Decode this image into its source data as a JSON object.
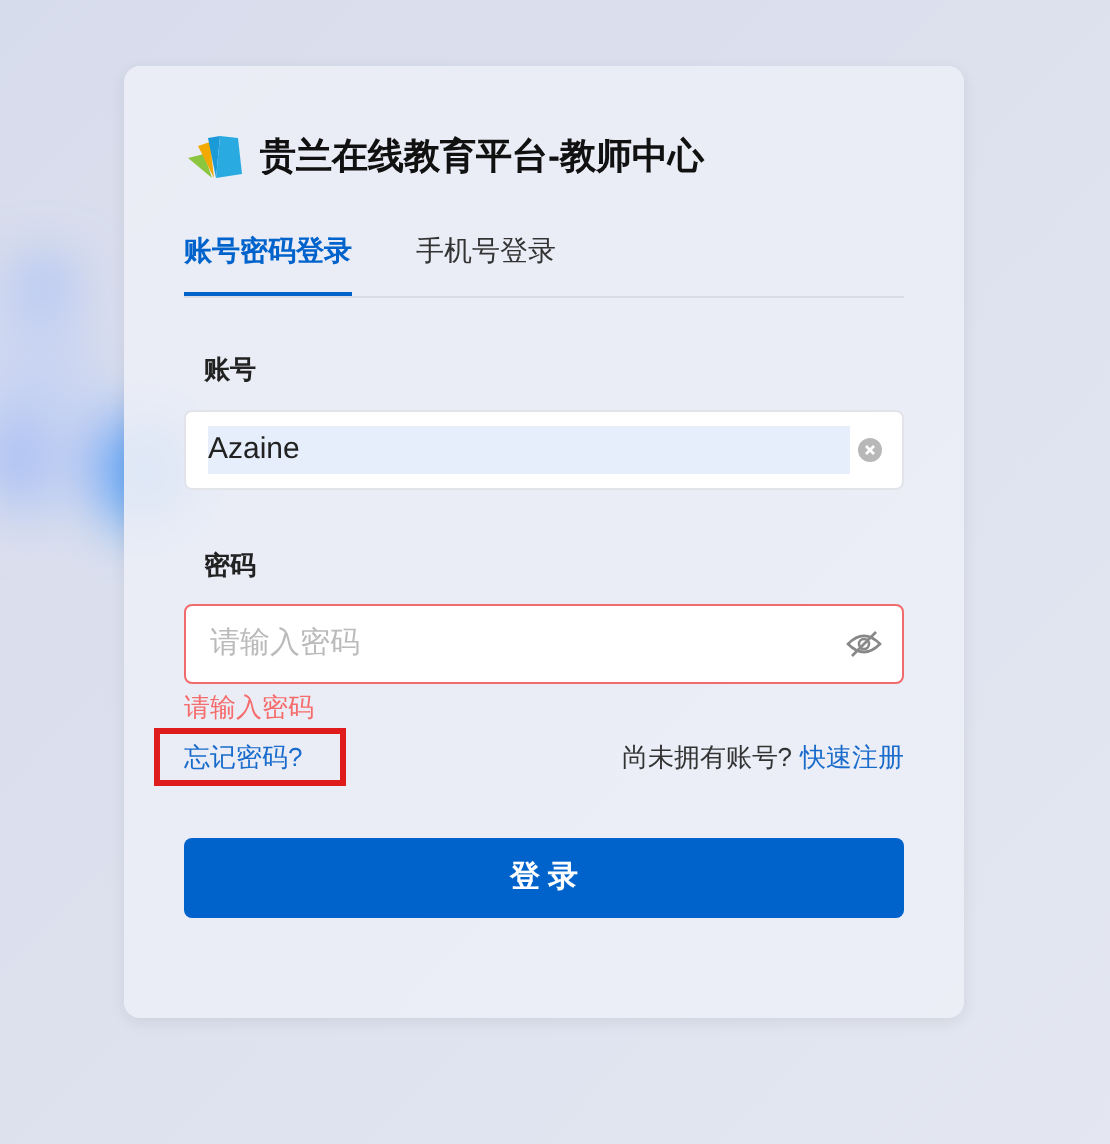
{
  "title": "贵兰在线教育平台-教师中心",
  "tabs": [
    {
      "label": "账号密码登录",
      "selected": true
    },
    {
      "label": "手机号登录",
      "selected": false
    }
  ],
  "account": {
    "label": "账号",
    "value": "Azaine",
    "selected_text": true
  },
  "password": {
    "label": "密码",
    "placeholder": "请输入密码",
    "error": "请输入密码",
    "invalid": true
  },
  "forgot": {
    "label": "忘记密码?",
    "highlighted": true
  },
  "register": {
    "prompt": "尚未拥有账号?",
    "link": "快速注册"
  },
  "submit": "登 录"
}
